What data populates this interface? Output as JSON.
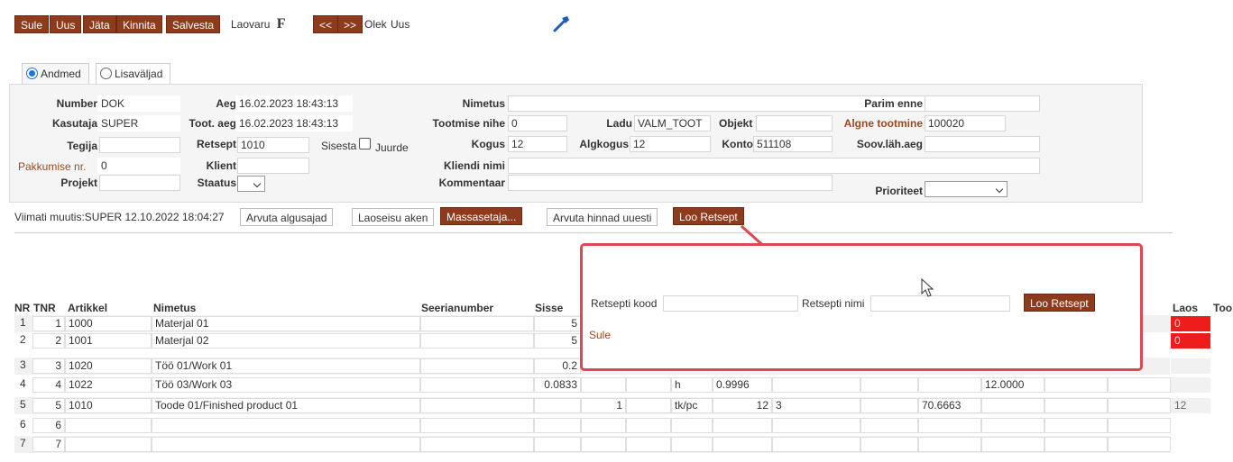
{
  "toolbar": {
    "buttons": [
      "Sule",
      "Uus",
      "Jäta",
      "Kinnita",
      "Salvesta"
    ],
    "laovaru_label": "Laovaru",
    "f_label": "F",
    "prev_label": "<<",
    "next_label": ">>",
    "status_label": "Olek:",
    "status_value": "Uus"
  },
  "tabs": {
    "andmed": "Andmed",
    "lisavaljad": "Lisaväljad"
  },
  "form": {
    "number_label": "Number",
    "number_value": "DOK",
    "kasutaja_label": "Kasutaja",
    "kasutaja_value": "SUPER",
    "tegija_label": "Tegija",
    "tegija_value": "",
    "pakkumise_label": "Pakkumise nr.",
    "pakkumise_value": "0",
    "projekt_label": "Projekt",
    "projekt_value": "",
    "aeg_label": "Aeg",
    "aeg_value": "16.02.2023 18:43:13",
    "toot_aeg_label": "Toot. aeg",
    "toot_aeg_value": "16.02.2023 18:43:13",
    "retsept_label": "Retsept",
    "retsept_value": "1010",
    "sisesta_label": "Sisesta",
    "juurde_label": "Juurde",
    "klient_label": "Klient",
    "klient_value": "",
    "staatus_label": "Staatus",
    "nimetus_label": "Nimetus",
    "nimetus_value": "",
    "tootmise_nihe_label": "Tootmise nihe",
    "tootmise_nihe_value": "0",
    "kogus_label": "Kogus",
    "kogus_value": "12",
    "kliendi_nimi_label": "Kliendi nimi",
    "kliendi_nimi_value": "",
    "kommentaar_label": "Kommentaar",
    "kommentaar_value": "",
    "ladu_label": "Ladu",
    "ladu_value": "VALM_TOOT",
    "algkogus_label": "Algkogus",
    "algkogus_value": "12",
    "objekt_label": "Objekt",
    "objekt_value": "",
    "konto_label": "Konto",
    "konto_value": "511108",
    "parim_enne_label": "Parim enne",
    "parim_enne_value": "",
    "algne_tootmine_label": "Algne tootmine",
    "algne_tootmine_value": "100020",
    "soov_lah_aeg_label": "Soov.läh.aeg",
    "soov_lah_aeg_value": "",
    "prioriteet_label": "Prioriteet"
  },
  "actions": {
    "viimati_muutis": "Viimati muutis:SUPER 12.10.2022 18:04:27",
    "arvuta_algusajad": "Arvuta algusajad",
    "laoseisu_aken": "Laoseisu aken",
    "massasetaja": "Massasetaja...",
    "arvuta_hinnad": "Arvuta hinnad uuesti",
    "loo_retsept": "Loo Retsept"
  },
  "table": {
    "headers": {
      "nr": "NR",
      "tnr": "TNR",
      "artikkel": "Artikkel",
      "nimetus": "Nimetus",
      "seerianumber": "Seerianumber",
      "sisse": "Sisse",
      "laos": "Laos",
      "too": "Too"
    },
    "rows": [
      {
        "nr": "1",
        "tnr": "1",
        "artikkel": "1000",
        "nimetus": "Materjal 01",
        "sisse": "5",
        "laos": "0"
      },
      {
        "nr": "2",
        "tnr": "2",
        "artikkel": "1001",
        "nimetus": "Materjal 02",
        "sisse": "5",
        "laos": "0"
      },
      {
        "nr": "3",
        "tnr": "3",
        "artikkel": "1020",
        "nimetus": "Töö 01/Work 01",
        "sisse": "0.2"
      },
      {
        "nr": "4",
        "tnr": "4",
        "artikkel": "1022",
        "nimetus": "Töö 03/Work 03",
        "sisse": "0.0833",
        "unit": "h",
        "value": "0.9996",
        "value2": "12.0000"
      },
      {
        "nr": "5",
        "tnr": "5",
        "artikkel": "1010",
        "nimetus": "Toode 01/Finished product 01",
        "qty": "1",
        "unit": "tk/pc",
        "value": "12",
        "extra": "3",
        "price": "70.6663",
        "laos": "12"
      },
      {
        "nr": "6",
        "tnr": "6"
      },
      {
        "nr": "7",
        "tnr": "7"
      }
    ]
  },
  "modal": {
    "kood_label": "Retsepti kood",
    "kood_value": "",
    "nimi_label": "Retsepti nimi",
    "nimi_value": "",
    "loo_button": "Loo Retsept",
    "sule_link": "Sule"
  },
  "colors": {
    "button": "#8e3a1c",
    "accent": "#9a4a20",
    "callout": "#e0474e",
    "warning": "#ef1c1c"
  }
}
